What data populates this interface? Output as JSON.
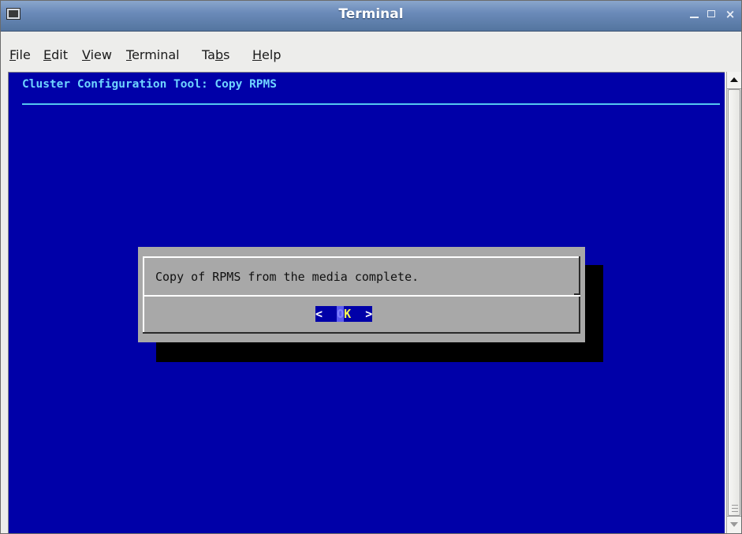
{
  "window": {
    "title": "Terminal",
    "minimize_glyph": "_",
    "close_glyph": "×"
  },
  "menubar": {
    "items": [
      {
        "prefix": "",
        "mnemonic": "F",
        "rest": "ile"
      },
      {
        "prefix": "",
        "mnemonic": "E",
        "rest": "dit"
      },
      {
        "prefix": "",
        "mnemonic": "V",
        "rest": "iew"
      },
      {
        "prefix": "",
        "mnemonic": "T",
        "rest": "erminal"
      },
      {
        "prefix": "Ta",
        "mnemonic": "b",
        "rest": "s"
      },
      {
        "prefix": "",
        "mnemonic": "H",
        "rest": "elp"
      }
    ]
  },
  "terminal": {
    "heading": "Cluster Configuration Tool: Copy RPMS",
    "background_color": "#0000a8",
    "heading_color": "#6fd4ff"
  },
  "dialog": {
    "message": "Copy of RPMS from the media complete.",
    "ok_button": {
      "left_bracket": "<",
      "gap": " ",
      "first_letter": "O",
      "second_letter": "K",
      "right_bracket": ">"
    }
  }
}
